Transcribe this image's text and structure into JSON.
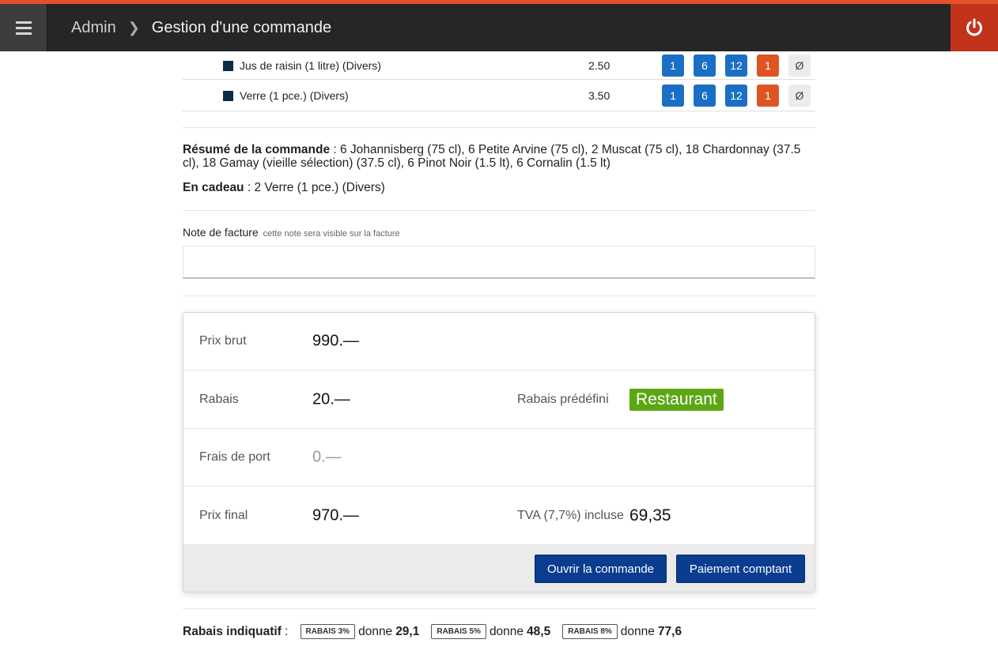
{
  "header": {
    "breadcrumb_root": "Admin",
    "breadcrumb_current": "Gestion d'une commande"
  },
  "products": [
    {
      "name": "Jus de raisin (1 litre) (Divers)",
      "price": "2.50"
    },
    {
      "name": "Verre (1 pce.) (Divers)",
      "price": "3.50"
    }
  ],
  "qty_buttons": {
    "b1": "1",
    "b6": "6",
    "b12": "12",
    "gift": "1",
    "none": "Ø"
  },
  "summary": {
    "label": "Résumé de la commande",
    "text": " : 6 Johannisberg (75 cl), 6 Petite Arvine (75 cl), 2 Muscat (75 cl), 18 Chardonnay (37.5 cl), 18 Gamay (vieille sélection) (37.5 cl), 6 Pinot Noir (1.5 lt), 6 Cornalin (1.5 lt)",
    "gift_label": "En cadeau",
    "gift_text": " : 2 Verre (1 pce.) (Divers)"
  },
  "note": {
    "label": "Note de facture",
    "hint": "cette note sera visible sur la facture",
    "value": ""
  },
  "totals": {
    "gross_label": "Prix brut",
    "gross": "990.—",
    "discount_label": "Rabais",
    "discount": "20.—",
    "preset_label": "Rabais prédéfini",
    "preset": "Restaurant",
    "shipping_label": "Frais de port",
    "shipping": "0.—",
    "final_label": "Prix final",
    "final": "970.—",
    "vat_label": "TVA (7,7%) incluse",
    "vat": "69,35"
  },
  "actions": {
    "open": "Ouvrir la commande",
    "cash": "Paiement comptant"
  },
  "indicative": {
    "label": "Rabais indiquatif",
    "sep": " :",
    "gives": "donne",
    "items": [
      {
        "tag": "RABAIS 3%",
        "amount": "29,1"
      },
      {
        "tag": "RABAIS 5%",
        "amount": "48,5"
      },
      {
        "tag": "RABAIS 8%",
        "amount": "77,6"
      }
    ]
  },
  "colors": {
    "accent": "#e4502a",
    "topbar": "#262626",
    "power": "#c3321a",
    "blue": "#1a6fc4",
    "gift": "#de5522",
    "badge": "#5aa713",
    "primary": "#0a3d8f"
  }
}
